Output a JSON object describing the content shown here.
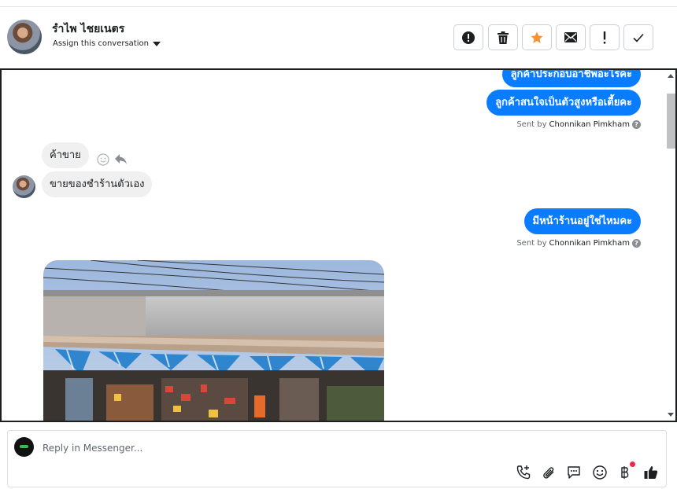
{
  "header": {
    "contact_name": "รำไพ ไชยเนตร",
    "assign_label": "Assign this conversation",
    "actions": [
      {
        "icon": "spam-alert-icon"
      },
      {
        "icon": "trash-icon"
      },
      {
        "icon": "star-icon",
        "color": "#f7923b"
      },
      {
        "icon": "envelope-icon"
      },
      {
        "icon": "exclamation-icon"
      },
      {
        "icon": "checkmark-icon"
      }
    ]
  },
  "thread": {
    "messages": [
      {
        "direction": "out",
        "text": "ลูกค้าประกอบอาชีพอะไรคะ"
      },
      {
        "direction": "out",
        "text": "ลูกค้าสนใจเป็นตัวสูงหรือเตี้ยคะ"
      },
      {
        "type": "meta",
        "sent_prefix": "Sent by",
        "sender": "Chonnikan Pimkham"
      },
      {
        "direction": "in",
        "text": "ค้าขาย"
      },
      {
        "direction": "in",
        "text": "ขายของชำร้านตัวเอง"
      },
      {
        "direction": "out",
        "text": "มีหน้าร้านอยู่ใช่ไหมคะ"
      },
      {
        "type": "meta",
        "sent_prefix": "Sent by",
        "sender": "Chonnikan Pimkham"
      },
      {
        "direction": "in",
        "type": "photo",
        "icon": "storefront-photo"
      }
    ],
    "help_glyph": "?",
    "colors": {
      "outgoing": "#0a7cff",
      "incoming": "#f0f0f0"
    }
  },
  "composer": {
    "placeholder": "Reply in Messenger...",
    "tools": [
      "phone-add-icon",
      "paperclip-icon",
      "saved-reply-icon",
      "emoji-icon",
      "baht-payment-icon",
      "thumbs-up-icon"
    ],
    "notification_color": "#f02849"
  }
}
